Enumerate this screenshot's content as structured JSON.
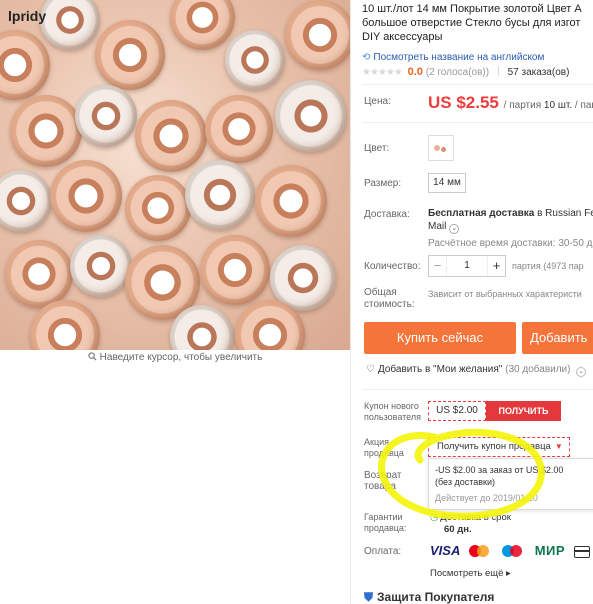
{
  "gallery": {
    "brand": "lpridy",
    "zoom_hint": "Наведите курсор, чтобы увеличить"
  },
  "product": {
    "title_lines": [
      "10 шт./лот 14 мм Покрытие золотой Цвет А",
      "большое отверстие Стекло бусы для изгот",
      "DIY аксессуары"
    ],
    "translate_link": "Посмотреть название на английском",
    "rating_score": "0.0",
    "rating_votes": "(2 голоса(ов))",
    "orders": "57 заказа(ов)"
  },
  "price": {
    "label": "Цена:",
    "amount": "US $2.55",
    "unit_prefix": "/ партия",
    "unit_qty": "10 шт.",
    "unit_suffix": "/ пак"
  },
  "options": {
    "color_label": "Цвет:",
    "size_label": "Размер:",
    "size_value": "14 мм"
  },
  "shipping": {
    "label": "Доставка:",
    "free_text": "Бесплатная доставка",
    "to_text": "в Russian Fede",
    "carrier": "Mail",
    "eta": "Расчётное время доставки: 30-50 дн"
  },
  "quantity": {
    "label": "Количество:",
    "value": "1",
    "minus": "−",
    "plus": "+",
    "available": "партия (4973 пар"
  },
  "total": {
    "label_line1": "Общая",
    "label_line2": "стоимость:",
    "value": "Зависит от выбранных характеристи"
  },
  "actions": {
    "buy_now": "Купить сейчас",
    "add_to_cart": "Добавить",
    "wishlist": "Добавить в \"Мои желания\"",
    "wishlist_count": "(30 добавили)"
  },
  "coupons": {
    "new_user_label_1": "Купон нового",
    "new_user_label_2": "пользователя",
    "new_user_amount": "US $2.00",
    "new_user_get": "ПОЛУЧИТЬ",
    "seller_label_1": "Акция",
    "seller_label_2": "продавца",
    "seller_button": "Получить купон продавца",
    "popup_line1": "-US $2.00 за заказ от US $2.00",
    "popup_line2": "(без доставки)",
    "popup_deadline": "Действует до 2019/01/10"
  },
  "returns": {
    "label_1": "Возврат",
    "label_2": "товара"
  },
  "guarantee": {
    "label_1": "Гарантии",
    "label_2": "продавца:",
    "delivery": "Доставка в срок",
    "days": "60 дн."
  },
  "payment": {
    "label": "Оплата:",
    "visa": "VISA",
    "mir": "МИР",
    "see_all": "Посмотреть ещё"
  },
  "protection": {
    "title": "Защита Покупателя"
  },
  "colors": {
    "accent_orange": "#f5743a",
    "price_red": "#f03c3c",
    "link_blue": "#2a5db0",
    "highlight_yellow": "#f4f40a"
  }
}
